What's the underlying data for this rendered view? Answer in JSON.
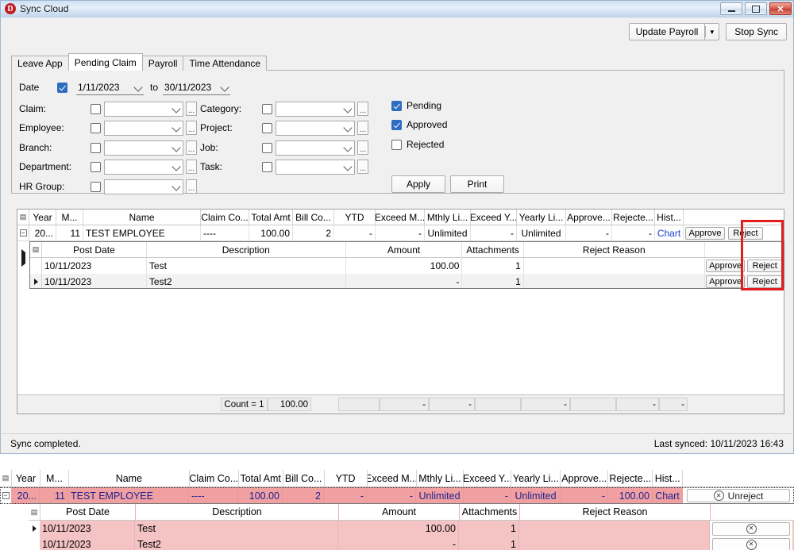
{
  "window": {
    "title": "Sync Cloud",
    "icon": "app-logo-icon",
    "minimize": "minimize-icon",
    "maximize": "maximize-icon",
    "close": "✕"
  },
  "toolbar": {
    "update_payroll": "Update Payroll",
    "dropdown_arrow": "▼",
    "stop_sync": "Stop Sync"
  },
  "tabs": [
    {
      "label": "Leave App",
      "active": false
    },
    {
      "label": "Pending Claim",
      "active": true
    },
    {
      "label": "Payroll",
      "active": false
    },
    {
      "label": "Time Attendance",
      "active": false
    }
  ],
  "filters": {
    "date_label": "Date",
    "date_enabled": true,
    "date_from": "1/11/2023",
    "date_to_label": "to",
    "date_to": "30/11/2023",
    "left_fields": [
      {
        "label": "Claim:",
        "checked": false,
        "value": ""
      },
      {
        "label": "Employee:",
        "checked": false,
        "value": ""
      },
      {
        "label": "Branch:",
        "checked": false,
        "value": ""
      },
      {
        "label": "Department:",
        "checked": false,
        "value": ""
      },
      {
        "label": "HR Group:",
        "checked": false,
        "value": ""
      }
    ],
    "right_fields": [
      {
        "label": "Category:",
        "checked": false,
        "value": ""
      },
      {
        "label": "Project:",
        "checked": false,
        "value": ""
      },
      {
        "label": "Job:",
        "checked": false,
        "value": ""
      },
      {
        "label": "Task:",
        "checked": false,
        "value": ""
      }
    ],
    "status": [
      {
        "label": "Pending",
        "checked": true
      },
      {
        "label": "Approved",
        "checked": true
      },
      {
        "label": "Rejected",
        "checked": false
      }
    ],
    "apply": "Apply",
    "print": "Print"
  },
  "grid": {
    "columns": [
      "Year",
      "M...",
      "Name",
      "Claim Co...",
      "Total Amt",
      "Bill Co...",
      "YTD",
      "Exceed M...",
      "Mthly Li...",
      "Exceed Y...",
      "Yearly Li...",
      "Approve...",
      "Rejecte...",
      "Hist..."
    ],
    "row": {
      "year": "20...",
      "month": "11",
      "name": "TEST EMPLOYEE",
      "claim_code": "----",
      "total_amt": "100.00",
      "bill_count": "2",
      "ytd": "-",
      "exceed_monthly": "-",
      "monthly_limit": "Unlimited",
      "exceed_yearly": "-",
      "yearly_limit": "Unlimited",
      "approved": "-",
      "rejected": "-",
      "history": "Chart",
      "approve_button": "Approve",
      "reject_button": "Reject"
    },
    "detail": {
      "columns": [
        "Post Date",
        "Description",
        "Amount",
        "Attachments",
        "Reject Reason"
      ],
      "rows": [
        {
          "post_date": "10/11/2023",
          "description": "Test",
          "amount": "100.00",
          "attachments": "1",
          "reject_reason": "",
          "approve_button": "Approve",
          "reject_button": "Reject"
        },
        {
          "post_date": "10/11/2023",
          "description": "Test2",
          "amount": "-",
          "attachments": "1",
          "reject_reason": "",
          "approve_button": "Approve",
          "reject_button": "Reject"
        }
      ]
    },
    "summary": {
      "count": "Count = 1",
      "total_amt": "100.00",
      "bill_count": "",
      "ytd": "-",
      "exceed_monthly": "-",
      "monthly_limit": "",
      "exceed_yearly": "-",
      "yearly_limit": "",
      "approved": "-",
      "rejected": "-"
    }
  },
  "statusbar": {
    "message": "Sync completed.",
    "last_synced": "Last synced: 10/11/2023 16:43"
  },
  "bottom_grid": {
    "columns": [
      "Year",
      "M...",
      "Name",
      "Claim Co...",
      "Total Amt",
      "Bill Co...",
      "YTD",
      "Exceed M...",
      "Mthly Li...",
      "Exceed Y...",
      "Yearly Li...",
      "Approve...",
      "Rejecte...",
      "Hist..."
    ],
    "row": {
      "year": "20...",
      "month": "11",
      "name": "TEST EMPLOYEE",
      "claim_code": "----",
      "total_amt": "100.00",
      "bill_count": "2",
      "ytd": "-",
      "exceed_monthly": "-",
      "monthly_limit": "Unlimited",
      "exceed_yearly": "-",
      "yearly_limit": "Unlimited",
      "approved": "-",
      "rejected": "100.00",
      "history": "Chart",
      "unreject_button": "Unreject"
    },
    "detail": {
      "columns": [
        "Post Date",
        "Description",
        "Amount",
        "Attachments",
        "Reject Reason"
      ],
      "rows": [
        {
          "post_date": "10/11/2023",
          "description": "Test",
          "amount": "100.00",
          "attachments": "1",
          "reject_reason": ""
        },
        {
          "post_date": "10/11/2023",
          "description": "Test2",
          "amount": "-",
          "attachments": "1",
          "reject_reason": ""
        }
      ]
    }
  },
  "annotation": {
    "color": "#e21d1d",
    "label": "reject-column-highlight"
  }
}
